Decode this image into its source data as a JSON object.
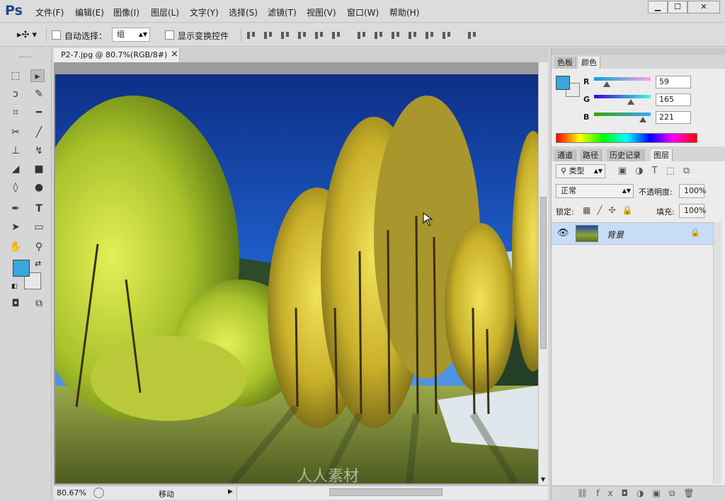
{
  "app": {
    "logo": "Ps",
    "menus": [
      "文件(F)",
      "编辑(E)",
      "图像(I)",
      "图层(L)",
      "文字(Y)",
      "选择(S)",
      "滤镜(T)",
      "视图(V)",
      "窗口(W)",
      "帮助(H)"
    ],
    "window_buttons": [
      "▁",
      "☐",
      "✕"
    ]
  },
  "options": {
    "auto_select_label": "自动选择：",
    "auto_select_value": "组",
    "show_transform_label": "显示变换控件",
    "auto_select_checked": false,
    "show_transform_checked": false
  },
  "document": {
    "tab_title": "P2-7.jpg @ 80.7%(RGB/8#)",
    "close": "×"
  },
  "status": {
    "zoom": "80.67%",
    "info": "移动"
  },
  "colors": {
    "foreground": "#3ba5dd",
    "background": "#e8e8e8",
    "accent": "#c7dcf6"
  },
  "color_panel": {
    "tabs": [
      "色板",
      "颜色"
    ],
    "active_tab": "颜色",
    "r_label": "R",
    "g_label": "G",
    "b_label": "B",
    "r": "59",
    "g": "165",
    "b": "221"
  },
  "layers_panel": {
    "tabs": [
      "通道",
      "路径",
      "历史记录",
      "图层"
    ],
    "active_tab": "图层",
    "filter": "类型",
    "blend_mode": "正常",
    "opacity_label": "不透明度:",
    "opacity": "100%",
    "lock_label": "锁定:",
    "fill_label": "填充:",
    "fill": "100%",
    "layer_name": "背景"
  },
  "watermark": "人人素材",
  "icons": [
    "move-tool-icon",
    "marquee-icon",
    "lasso-icon",
    "magic-wand-icon",
    "crop-icon",
    "eyedropper-icon",
    "healing-brush-icon",
    "brush-icon",
    "clone-stamp-icon",
    "history-brush-icon",
    "eraser-icon",
    "gradient-icon",
    "blur-icon",
    "dodge-icon",
    "pen-icon",
    "type-icon",
    "path-selection-icon",
    "rectangle-icon",
    "hand-icon",
    "zoom-icon",
    "visibility-eye-icon",
    "lock-icon"
  ]
}
